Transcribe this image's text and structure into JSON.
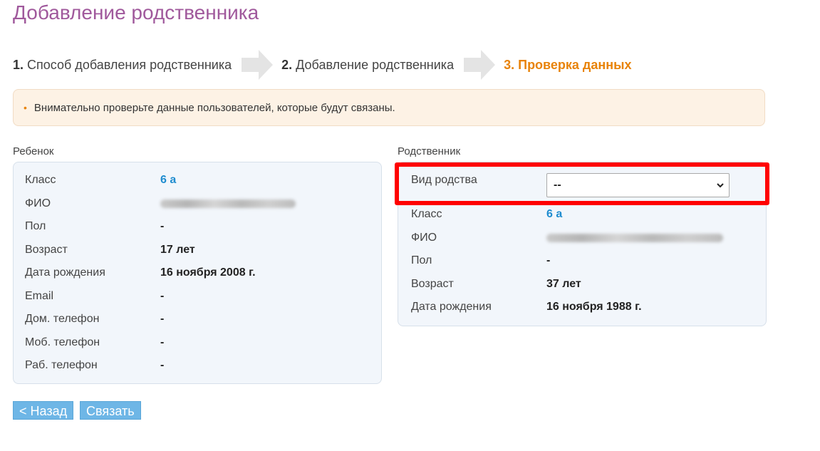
{
  "page": {
    "title": "Добавление родственника"
  },
  "steps": [
    {
      "num": "1.",
      "label": "Способ добавления родственника"
    },
    {
      "num": "2.",
      "label": "Добавление родственника"
    },
    {
      "num": "3.",
      "label": "Проверка данных"
    }
  ],
  "notice": {
    "bullet": "•",
    "text": "Внимательно проверьте данные пользователей, которые будут связаны."
  },
  "child": {
    "heading": "Ребенок",
    "rows": [
      {
        "label": "Класс",
        "value": "6 а"
      },
      {
        "label": "ФИО",
        "value": ""
      },
      {
        "label": "Пол",
        "value": "-"
      },
      {
        "label": "Возраст",
        "value": "17 лет"
      },
      {
        "label": "Дата рождения",
        "value": "16 ноября 2008 г."
      },
      {
        "label": "Email",
        "value": "-"
      },
      {
        "label": "Дом. телефон",
        "value": "-"
      },
      {
        "label": "Моб. телефон",
        "value": "-"
      },
      {
        "label": "Раб. телефон",
        "value": "-"
      }
    ]
  },
  "relative": {
    "heading": "Родственник",
    "kinship_label": "Вид родства",
    "kinship_value": "--",
    "rows": [
      {
        "label": "Класс",
        "value": "6 а"
      },
      {
        "label": "ФИО",
        "value": ""
      },
      {
        "label": "Пол",
        "value": "-"
      },
      {
        "label": "Возраст",
        "value": "37 лет"
      },
      {
        "label": "Дата рождения",
        "value": "16 ноября 1988 г."
      }
    ]
  },
  "buttons": {
    "back": "< Назад",
    "link": "Связать"
  },
  "colors": {
    "title": "#a0599c",
    "active_step": "#e8830a",
    "link": "#1f8ccf",
    "highlight": "#ff0000",
    "button": "#6eb6e6"
  }
}
